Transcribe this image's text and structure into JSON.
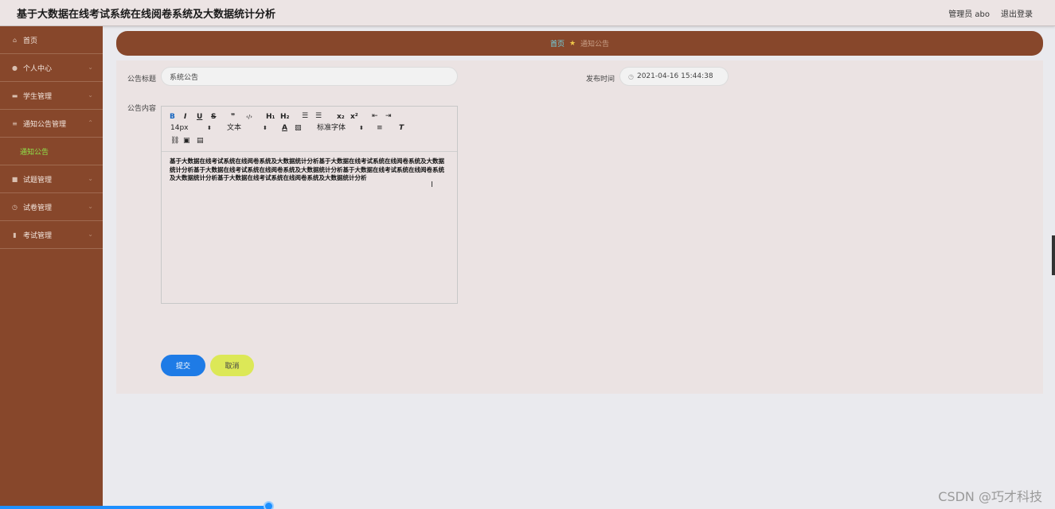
{
  "header": {
    "title": "基于大数据在线考试系统在线阅卷系统及大数据统计分析",
    "user": "管理员 abo",
    "logout": "退出登录"
  },
  "sidebar": {
    "items": [
      {
        "label": "首页",
        "icon": "home-icon"
      },
      {
        "label": "个人中心",
        "icon": "person-icon"
      },
      {
        "label": "学生管理",
        "icon": "list-icon"
      },
      {
        "label": "通知公告管理",
        "icon": "settings-icon"
      },
      {
        "label": "试题管理",
        "icon": "chat-icon"
      },
      {
        "label": "试卷管理",
        "icon": "clock-icon"
      },
      {
        "label": "考试管理",
        "icon": "chart-icon"
      }
    ],
    "sub_item": "通知公告"
  },
  "breadcrumb": {
    "home": "首页",
    "current": "通知公告"
  },
  "form": {
    "title_label": "公告标题",
    "title_value": "系统公告",
    "time_label": "发布时间",
    "time_value": "2021-04-16 15:44:38",
    "content_label": "公告内容",
    "content_text": "基于大数据在线考试系统在线阅卷系统及大数据统计分析基于大数据在线考试系统在线阅卷系统及大数据统计分析基于大数据在线考试系统在线阅卷系统及大数据统计分析基于大数据在线考试系统在线阅卷系统及大数据统计分析基于大数据在线考试系统在线阅卷系统及大数据统计分析"
  },
  "toolbar": {
    "bold": "B",
    "italic": "I",
    "underline": "U",
    "strike": "S",
    "quote": "❞",
    "code": "‹/›",
    "h1": "H₁",
    "h2": "H₂",
    "sub": "x₂",
    "sup": "x²",
    "font_size": "14px",
    "text_type": "文本",
    "font_family": "标准字体"
  },
  "buttons": {
    "submit": "提交",
    "cancel": "取消"
  },
  "watermark": "CSDN @巧才科技",
  "colors": {
    "sidebar": "#87472b",
    "submit": "#1e7be6",
    "cancel": "#dce857",
    "active_sub": "#8fe34a"
  }
}
